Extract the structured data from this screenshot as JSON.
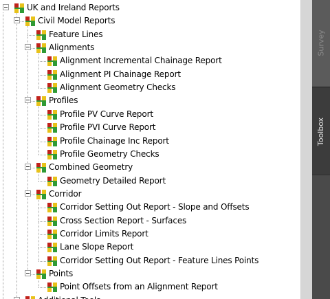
{
  "tree": {
    "nodes": [
      {
        "label": "UK and Ireland Reports",
        "level": 0,
        "expanded": true
      },
      {
        "label": "Civil Model Reports",
        "level": 1,
        "expanded": true
      },
      {
        "label": "Feature Lines",
        "level": 2
      },
      {
        "label": "Alignments",
        "level": 2,
        "expanded": true
      },
      {
        "label": "Alignment Incremental Chainage Report",
        "level": 3
      },
      {
        "label": "Alignment PI Chainage Report",
        "level": 3
      },
      {
        "label": "Alignment Geometry Checks",
        "level": 3
      },
      {
        "label": "Profiles",
        "level": 2,
        "expanded": true
      },
      {
        "label": "Profile PV Curve Report",
        "level": 3
      },
      {
        "label": "Profile PVI Curve Report",
        "level": 3
      },
      {
        "label": "Profile Chainage Inc Report",
        "level": 3
      },
      {
        "label": "Profile Geometry Checks",
        "level": 3
      },
      {
        "label": "Combined Geometry",
        "level": 2,
        "expanded": true
      },
      {
        "label": "Geometry Detailed Report",
        "level": 3
      },
      {
        "label": "Corridor",
        "level": 2,
        "expanded": true
      },
      {
        "label": "Corridor Setting Out Report - Slope and Offsets",
        "level": 3
      },
      {
        "label": "Cross Section Report - Surfaces",
        "level": 3
      },
      {
        "label": "Corridor Limits Report",
        "level": 3
      },
      {
        "label": "Lane Slope Report",
        "level": 3
      },
      {
        "label": "Corridor Setting Out Report - Feature Lines Points",
        "level": 3
      },
      {
        "label": "Points",
        "level": 2,
        "expanded": true
      },
      {
        "label": "Point Offsets from an Alignment Report",
        "level": 3
      },
      {
        "label": "Additional Tools",
        "level": 1,
        "expanded": true
      }
    ]
  },
  "side_tabs": {
    "survey": "Survey",
    "toolbox": "Toolbox"
  },
  "colors": {
    "panel_bg": "#4a4a4a",
    "scrollbar": "#d6d6d6",
    "icon_red": "#c0221b",
    "icon_green": "#2f9a35",
    "icon_yellow": "#e8c21a"
  }
}
